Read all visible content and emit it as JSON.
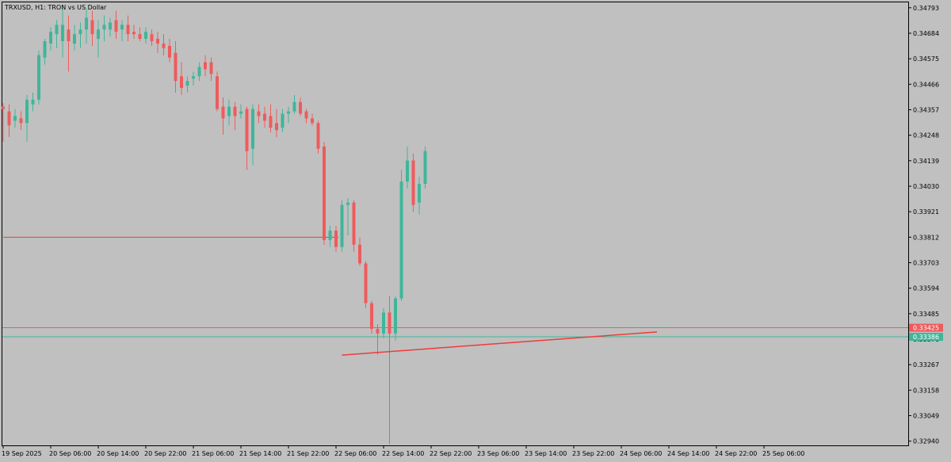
{
  "symbol_text": "TRXUSD, H1:  TRON vs US Dollar",
  "colors": {
    "background": "#c0c0c0",
    "bull": "#3fb699",
    "bear": "#ef5b5b",
    "bid_line": "#ef5b5b",
    "ask_line": "#3fb699",
    "manual_line": "#ef3b3b",
    "axis": "#000000"
  },
  "chart_data": {
    "type": "candlestick",
    "title": "TRXUSD, H1:  TRON vs US Dollar",
    "xlabel": "",
    "ylabel": "",
    "ylim": [
      0.32922,
      0.34816
    ],
    "grid": false,
    "y_ticks": [
      "0.34793",
      "0.34684",
      "0.34575",
      "0.34466",
      "0.34357",
      "0.34248",
      "0.34139",
      "0.34030",
      "0.33921",
      "0.33812",
      "0.33703",
      "0.33594",
      "0.33485",
      "0.33376",
      "0.33267",
      "0.33158",
      "0.33049",
      "0.32940"
    ],
    "y_tick_values": [
      0.34793,
      0.34684,
      0.34575,
      0.34466,
      0.34357,
      0.34248,
      0.34139,
      0.3403,
      0.33921,
      0.33812,
      0.33703,
      0.33594,
      0.33485,
      0.33376,
      0.33267,
      0.33158,
      0.33049,
      0.3294
    ],
    "x_ticks": [
      "19 Sep 2025",
      "20 Sep 06:00",
      "20 Sep 14:00",
      "20 Sep 22:00",
      "21 Sep 06:00",
      "21 Sep 14:00",
      "21 Sep 22:00",
      "22 Sep 06:00",
      "22 Sep 14:00",
      "22 Sep 22:00",
      "23 Sep 06:00",
      "23 Sep 14:00",
      "23 Sep 22:00",
      "24 Sep 06:00",
      "24 Sep 14:00",
      "24 Sep 22:00",
      "25 Sep 06:00"
    ],
    "x_tick_bar_index": [
      0,
      8,
      16,
      24,
      32,
      40,
      48,
      56,
      64,
      72,
      80,
      88,
      96,
      104,
      112,
      120,
      128
    ],
    "price_labels": {
      "bid": "0.33425",
      "ask": "0.33386"
    },
    "horizontal_level": 0.33812,
    "trendline": {
      "from": [
        57,
        0.33308
      ],
      "to": [
        110,
        0.33407
      ]
    },
    "candles": [
      {
        "o": 0.3437,
        "h": 0.34385,
        "l": 0.3422,
        "c": 0.3436
      },
      {
        "o": 0.3435,
        "h": 0.3438,
        "l": 0.3424,
        "c": 0.3429
      },
      {
        "o": 0.3431,
        "h": 0.3436,
        "l": 0.3428,
        "c": 0.3433
      },
      {
        "o": 0.3432,
        "h": 0.3435,
        "l": 0.3427,
        "c": 0.343
      },
      {
        "o": 0.343,
        "h": 0.3442,
        "l": 0.3422,
        "c": 0.344
      },
      {
        "o": 0.3438,
        "h": 0.3443,
        "l": 0.3435,
        "c": 0.344
      },
      {
        "o": 0.344,
        "h": 0.3461,
        "l": 0.3438,
        "c": 0.3459
      },
      {
        "o": 0.3458,
        "h": 0.3466,
        "l": 0.3455,
        "c": 0.3465
      },
      {
        "o": 0.3464,
        "h": 0.3471,
        "l": 0.3461,
        "c": 0.3469
      },
      {
        "o": 0.3468,
        "h": 0.3474,
        "l": 0.3462,
        "c": 0.3472
      },
      {
        "o": 0.3465,
        "h": 0.3479,
        "l": 0.3458,
        "c": 0.3472
      },
      {
        "o": 0.347,
        "h": 0.3476,
        "l": 0.3452,
        "c": 0.3465
      },
      {
        "o": 0.3464,
        "h": 0.3472,
        "l": 0.3461,
        "c": 0.3468
      },
      {
        "o": 0.3468,
        "h": 0.3473,
        "l": 0.3462,
        "c": 0.347
      },
      {
        "o": 0.347,
        "h": 0.3479,
        "l": 0.3464,
        "c": 0.3475
      },
      {
        "o": 0.3474,
        "h": 0.3478,
        "l": 0.3463,
        "c": 0.3468
      },
      {
        "o": 0.3466,
        "h": 0.3474,
        "l": 0.3458,
        "c": 0.347
      },
      {
        "o": 0.347,
        "h": 0.3476,
        "l": 0.3465,
        "c": 0.3472
      },
      {
        "o": 0.347,
        "h": 0.3475,
        "l": 0.3467,
        "c": 0.3473
      },
      {
        "o": 0.3474,
        "h": 0.3478,
        "l": 0.3466,
        "c": 0.3469
      },
      {
        "o": 0.347,
        "h": 0.3474,
        "l": 0.3465,
        "c": 0.3472
      },
      {
        "o": 0.3472,
        "h": 0.3476,
        "l": 0.3465,
        "c": 0.3468
      },
      {
        "o": 0.3469,
        "h": 0.3472,
        "l": 0.3466,
        "c": 0.3468
      },
      {
        "o": 0.3468,
        "h": 0.3471,
        "l": 0.3465,
        "c": 0.3466
      },
      {
        "o": 0.3466,
        "h": 0.3471,
        "l": 0.3464,
        "c": 0.3469
      },
      {
        "o": 0.3468,
        "h": 0.347,
        "l": 0.3463,
        "c": 0.3465
      },
      {
        "o": 0.3466,
        "h": 0.3469,
        "l": 0.346,
        "c": 0.3464
      },
      {
        "o": 0.3464,
        "h": 0.3468,
        "l": 0.3459,
        "c": 0.3462
      },
      {
        "o": 0.3463,
        "h": 0.3466,
        "l": 0.3456,
        "c": 0.3458
      },
      {
        "o": 0.346,
        "h": 0.3465,
        "l": 0.3443,
        "c": 0.3448
      },
      {
        "o": 0.345,
        "h": 0.3456,
        "l": 0.3442,
        "c": 0.3445
      },
      {
        "o": 0.3446,
        "h": 0.345,
        "l": 0.3443,
        "c": 0.3448
      },
      {
        "o": 0.3449,
        "h": 0.3452,
        "l": 0.3446,
        "c": 0.345
      },
      {
        "o": 0.345,
        "h": 0.3456,
        "l": 0.3448,
        "c": 0.3454
      },
      {
        "o": 0.3456,
        "h": 0.3459,
        "l": 0.345,
        "c": 0.3453
      },
      {
        "o": 0.3456,
        "h": 0.3458,
        "l": 0.3448,
        "c": 0.3451
      },
      {
        "o": 0.345,
        "h": 0.3452,
        "l": 0.3435,
        "c": 0.3436
      },
      {
        "o": 0.3437,
        "h": 0.3441,
        "l": 0.3425,
        "c": 0.3432
      },
      {
        "o": 0.3433,
        "h": 0.344,
        "l": 0.3429,
        "c": 0.3437
      },
      {
        "o": 0.3437,
        "h": 0.3439,
        "l": 0.3427,
        "c": 0.3433
      },
      {
        "o": 0.3434,
        "h": 0.3438,
        "l": 0.3432,
        "c": 0.3435
      },
      {
        "o": 0.3436,
        "h": 0.3437,
        "l": 0.341,
        "c": 0.3418
      },
      {
        "o": 0.3419,
        "h": 0.3438,
        "l": 0.3412,
        "c": 0.3436
      },
      {
        "o": 0.3435,
        "h": 0.3438,
        "l": 0.343,
        "c": 0.3433
      },
      {
        "o": 0.3434,
        "h": 0.3437,
        "l": 0.3428,
        "c": 0.3431
      },
      {
        "o": 0.3433,
        "h": 0.3438,
        "l": 0.3426,
        "c": 0.3428
      },
      {
        "o": 0.343,
        "h": 0.3436,
        "l": 0.3424,
        "c": 0.3427
      },
      {
        "o": 0.3428,
        "h": 0.3436,
        "l": 0.3426,
        "c": 0.3434
      },
      {
        "o": 0.3434,
        "h": 0.3437,
        "l": 0.343,
        "c": 0.3435
      },
      {
        "o": 0.3435,
        "h": 0.3442,
        "l": 0.3434,
        "c": 0.3439
      },
      {
        "o": 0.3439,
        "h": 0.3441,
        "l": 0.3433,
        "c": 0.3434
      },
      {
        "o": 0.3435,
        "h": 0.3436,
        "l": 0.343,
        "c": 0.3432
      },
      {
        "o": 0.3432,
        "h": 0.3434,
        "l": 0.3429,
        "c": 0.343
      },
      {
        "o": 0.343,
        "h": 0.3431,
        "l": 0.3417,
        "c": 0.3419
      },
      {
        "o": 0.342,
        "h": 0.3422,
        "l": 0.3378,
        "c": 0.338
      },
      {
        "o": 0.338,
        "h": 0.3386,
        "l": 0.3377,
        "c": 0.3384
      },
      {
        "o": 0.3384,
        "h": 0.3386,
        "l": 0.3375,
        "c": 0.3377
      },
      {
        "o": 0.3377,
        "h": 0.3397,
        "l": 0.3375,
        "c": 0.3395
      },
      {
        "o": 0.3395,
        "h": 0.3398,
        "l": 0.3382,
        "c": 0.3396
      },
      {
        "o": 0.3396,
        "h": 0.3397,
        "l": 0.3375,
        "c": 0.3378
      },
      {
        "o": 0.3378,
        "h": 0.3381,
        "l": 0.3369,
        "c": 0.337
      },
      {
        "o": 0.337,
        "h": 0.3371,
        "l": 0.3351,
        "c": 0.3353
      },
      {
        "o": 0.3353,
        "h": 0.3354,
        "l": 0.334,
        "c": 0.3342
      },
      {
        "o": 0.3342,
        "h": 0.3344,
        "l": 0.3331,
        "c": 0.334
      },
      {
        "o": 0.334,
        "h": 0.3351,
        "l": 0.3338,
        "c": 0.3349
      },
      {
        "o": 0.3349,
        "h": 0.3356,
        "l": 0.32928,
        "c": 0.334
      },
      {
        "o": 0.334,
        "h": 0.3356,
        "l": 0.3337,
        "c": 0.3355
      },
      {
        "o": 0.3355,
        "h": 0.341,
        "l": 0.3354,
        "c": 0.3405
      },
      {
        "o": 0.3405,
        "h": 0.342,
        "l": 0.3402,
        "c": 0.3414
      },
      {
        "o": 0.3414,
        "h": 0.3417,
        "l": 0.3392,
        "c": 0.3395
      },
      {
        "o": 0.3396,
        "h": 0.3407,
        "l": 0.3391,
        "c": 0.3404
      },
      {
        "o": 0.3404,
        "h": 0.342,
        "l": 0.3402,
        "c": 0.3418
      }
    ]
  }
}
